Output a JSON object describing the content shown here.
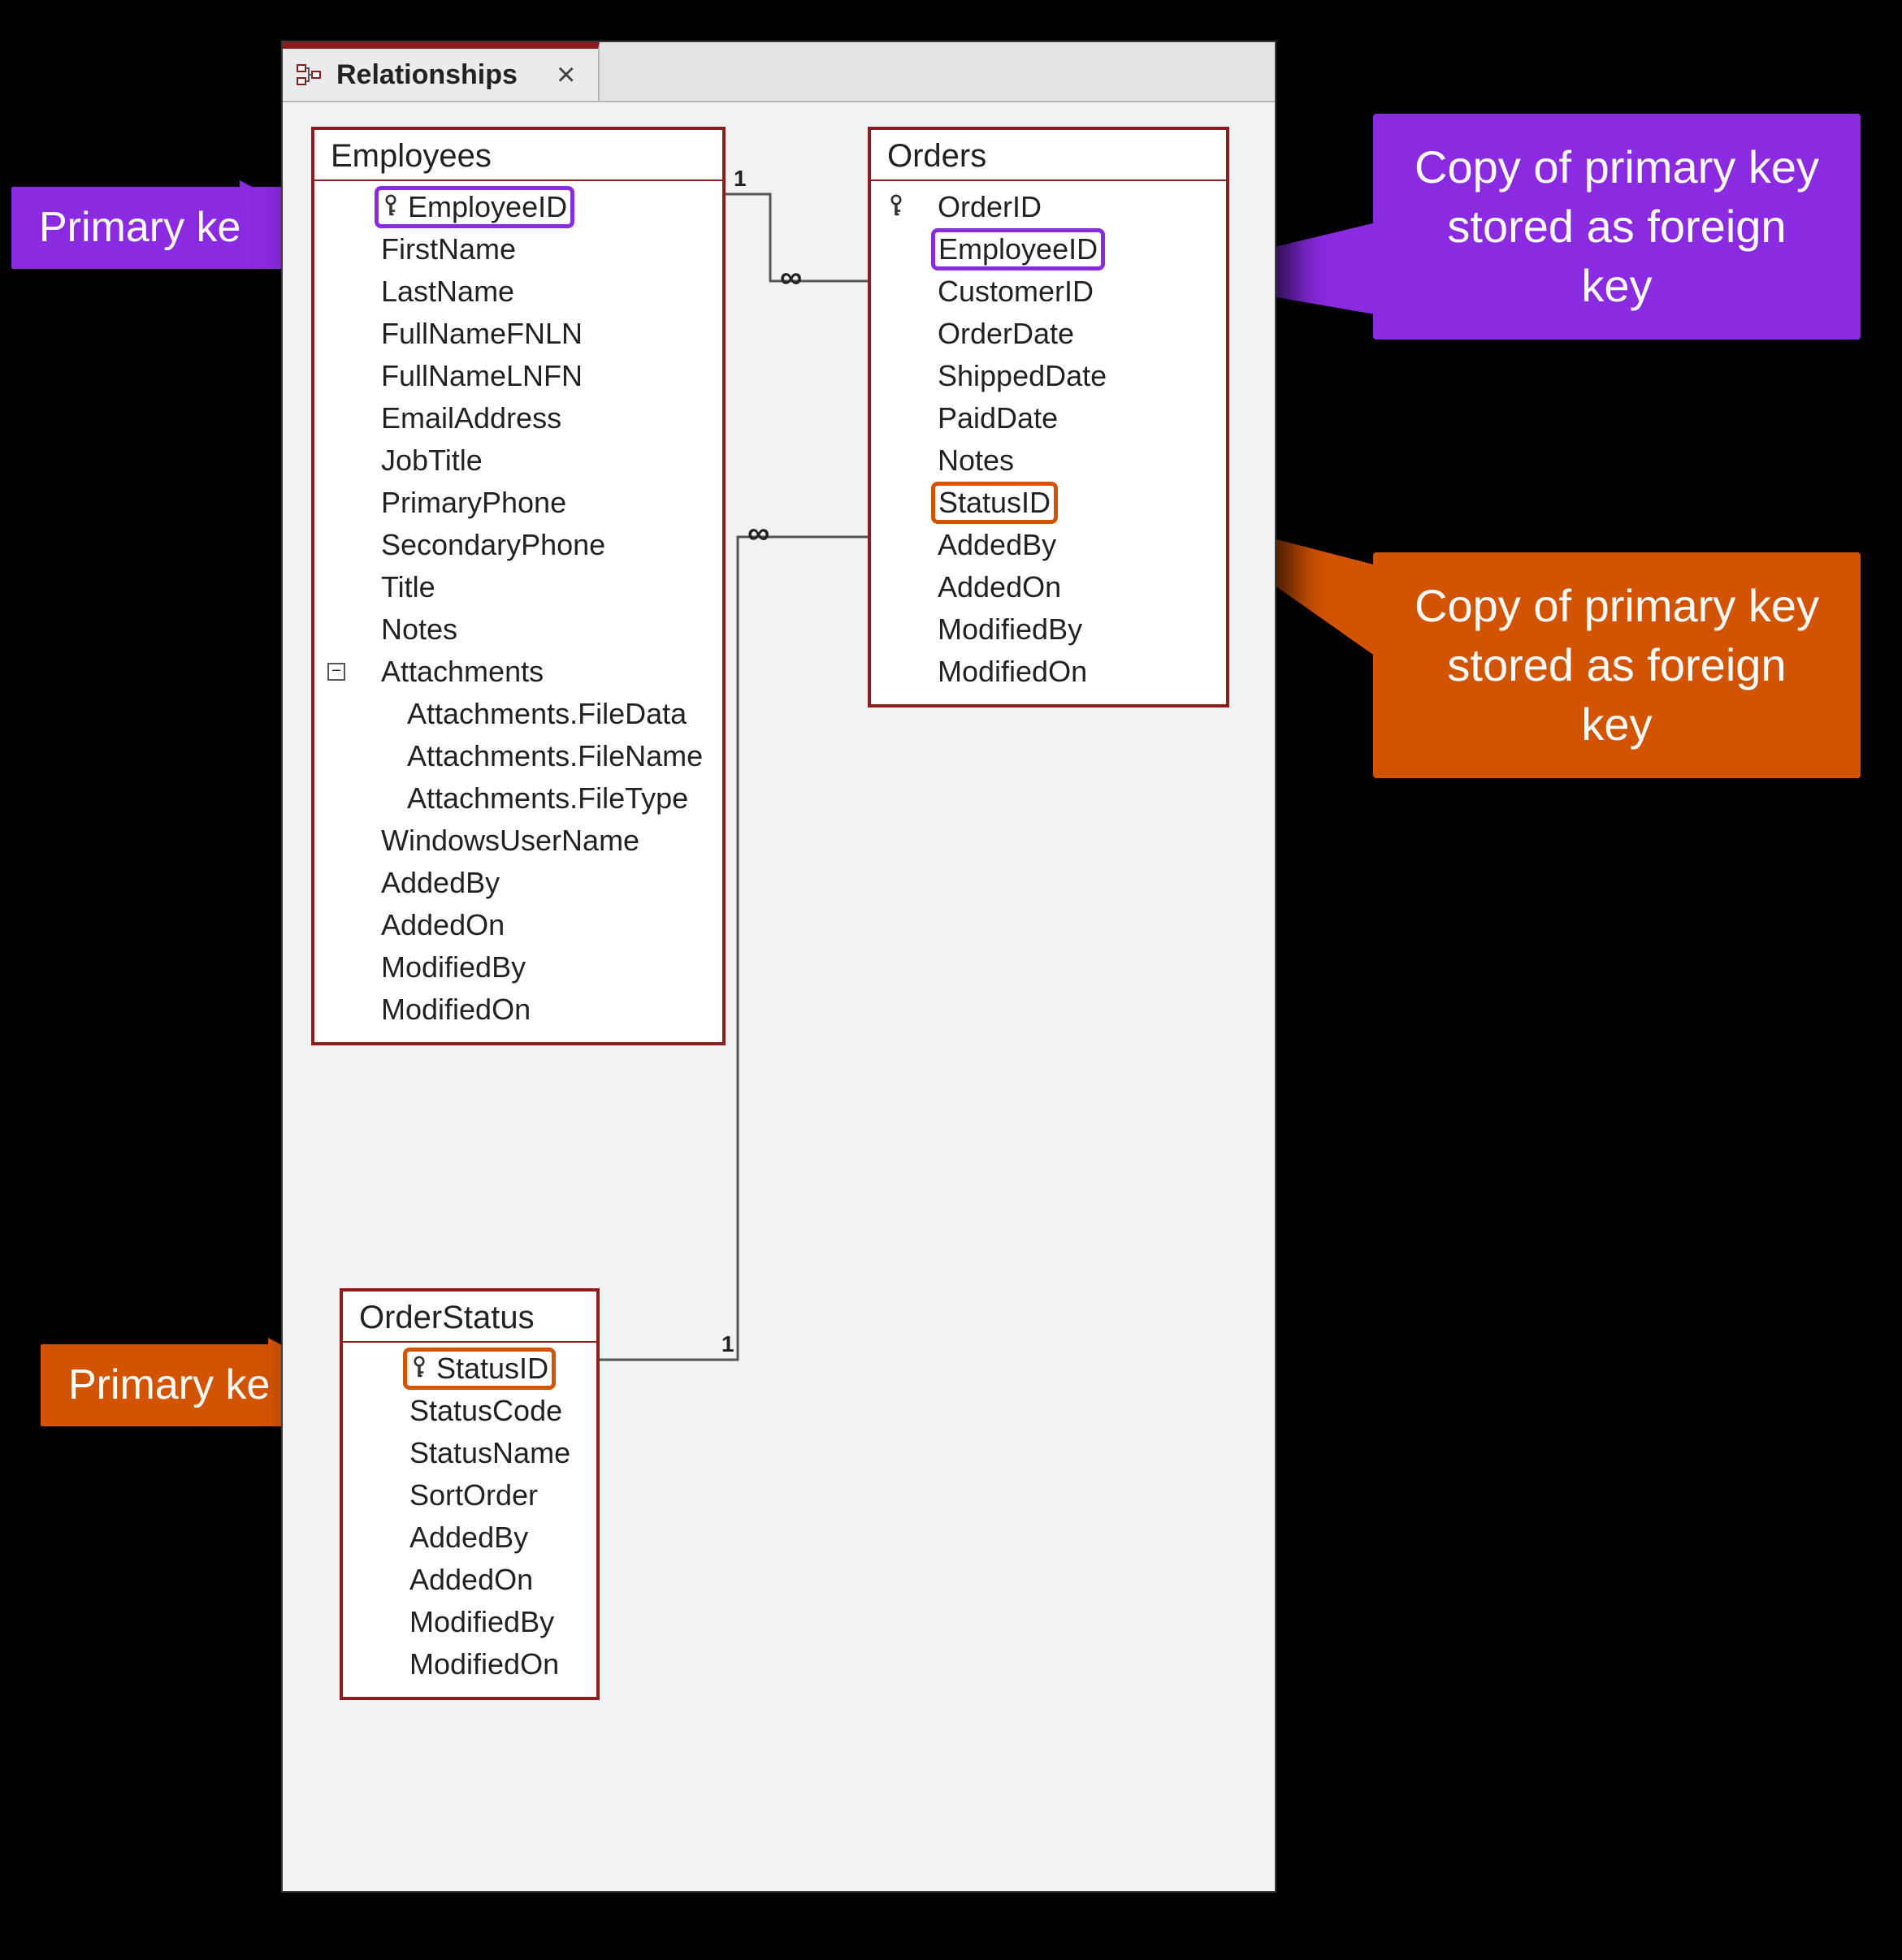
{
  "tab": {
    "title": "Relationships",
    "close_glyph": "×"
  },
  "annotations": {
    "primary_key_label": "Primary key",
    "foreign_key_label": "Copy of primary key stored as foreign key"
  },
  "relationships": [
    {
      "from_table": "Employees",
      "from_field": "EmployeeID",
      "to_table": "Orders",
      "to_field": "EmployeeID",
      "one_label": "1",
      "many_label": "∞"
    },
    {
      "from_table": "OrderStatus",
      "from_field": "StatusID",
      "to_table": "Orders",
      "to_field": "StatusID",
      "one_label": "1",
      "many_label": "∞"
    }
  ],
  "tables": {
    "employees": {
      "title": "Employees",
      "fields": [
        {
          "name": "EmployeeID",
          "pk": true,
          "highlight": "purple"
        },
        {
          "name": "FirstName"
        },
        {
          "name": "LastName"
        },
        {
          "name": "FullNameFNLN"
        },
        {
          "name": "FullNameLNFN"
        },
        {
          "name": "EmailAddress"
        },
        {
          "name": "JobTitle"
        },
        {
          "name": "PrimaryPhone"
        },
        {
          "name": "SecondaryPhone"
        },
        {
          "name": "Title"
        },
        {
          "name": "Notes"
        },
        {
          "name": "Attachments",
          "expand": "−"
        },
        {
          "name": "Attachments.FileData",
          "indent": 2
        },
        {
          "name": "Attachments.FileName",
          "indent": 2
        },
        {
          "name": "Attachments.FileType",
          "indent": 2
        },
        {
          "name": "WindowsUserName"
        },
        {
          "name": "AddedBy"
        },
        {
          "name": "AddedOn"
        },
        {
          "name": "ModifiedBy"
        },
        {
          "name": "ModifiedOn"
        }
      ]
    },
    "orders": {
      "title": "Orders",
      "fields": [
        {
          "name": "OrderID",
          "pk": true
        },
        {
          "name": "EmployeeID",
          "highlight": "purple"
        },
        {
          "name": "CustomerID"
        },
        {
          "name": "OrderDate"
        },
        {
          "name": "ShippedDate"
        },
        {
          "name": "PaidDate"
        },
        {
          "name": "Notes"
        },
        {
          "name": "StatusID",
          "highlight": "orange"
        },
        {
          "name": "AddedBy"
        },
        {
          "name": "AddedOn"
        },
        {
          "name": "ModifiedBy"
        },
        {
          "name": "ModifiedOn"
        }
      ]
    },
    "orderstatus": {
      "title": "OrderStatus",
      "fields": [
        {
          "name": "StatusID",
          "pk": true,
          "highlight": "orange"
        },
        {
          "name": "StatusCode"
        },
        {
          "name": "StatusName"
        },
        {
          "name": "SortOrder"
        },
        {
          "name": "AddedBy"
        },
        {
          "name": "AddedOn"
        },
        {
          "name": "ModifiedBy"
        },
        {
          "name": "ModifiedOn"
        }
      ]
    }
  }
}
